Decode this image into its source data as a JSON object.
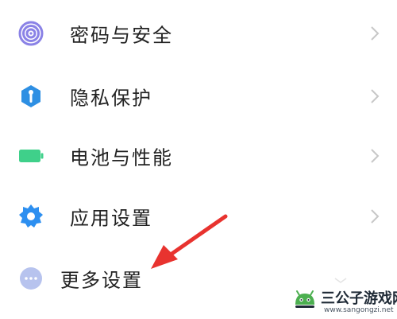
{
  "settings": {
    "items": [
      {
        "label": "密码与安全",
        "icon": "fingerprint-icon",
        "icon_color": "#7b73e0",
        "has_chevron": true
      },
      {
        "label": "隐私保护",
        "icon": "privacy-shield-icon",
        "icon_color": "#2e8fe3",
        "has_chevron": true
      },
      {
        "label": "电池与性能",
        "icon": "battery-icon",
        "icon_color": "#3fd08a",
        "has_chevron": true
      },
      {
        "label": "应用设置",
        "icon": "gear-icon",
        "icon_color": "#2d8ff0",
        "has_chevron": true
      },
      {
        "label": "更多设置",
        "icon": "more-dots-icon",
        "icon_color": "#9fb0e8",
        "has_chevron": false
      }
    ]
  },
  "annotation": {
    "arrow_color": "#e8332f",
    "points_to": "更多设置"
  },
  "watermark": {
    "title": "三公子游戏网",
    "url": "www.sangongzi.net",
    "icon": "android-mascot-icon",
    "color": "#4caf50"
  },
  "colors": {
    "chevron": "#c7c7c7",
    "text": "#222222",
    "background": "#ffffff"
  }
}
